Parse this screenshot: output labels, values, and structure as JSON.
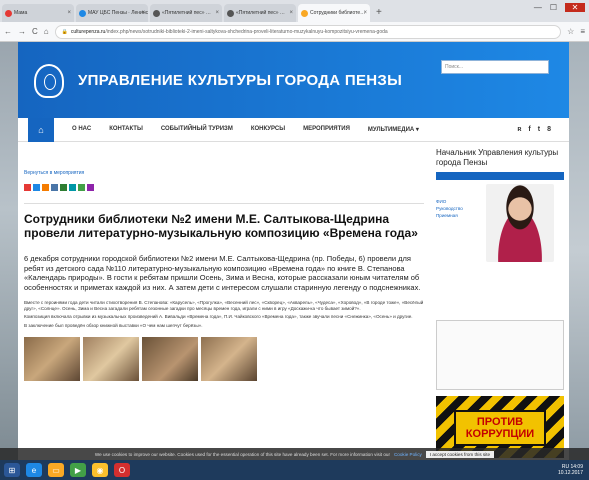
{
  "browser": {
    "tabs": [
      {
        "label": "Мама",
        "active": false,
        "color": "#e53935"
      },
      {
        "label": "МАУ ЦБС Пензы · Ленинс",
        "active": false,
        "color": "#1e88e5"
      },
      {
        "label": "«Пятилетний пес» …",
        "active": false,
        "color": "#555555"
      },
      {
        "label": "«Пятилетний пес» …",
        "active": false,
        "color": "#555555"
      },
      {
        "label": "Сотрудники библиоте…",
        "active": true,
        "color": "#f9a825"
      }
    ],
    "new_tab": "+",
    "url_host": "culturepenza.ru",
    "url_path": "/index.php/news/sotrudniki-biblioteki-2-imeni-saltykova-shchedrina-proveli-literaturno-muzykalnuyu-kompozitsiyu-vremena-goda"
  },
  "site": {
    "title": "УПРАВЛЕНИЕ КУЛЬТУРЫ ГОРОДА ПЕНЗЫ",
    "search_placeholder": "Поиск..."
  },
  "nav": {
    "items": [
      "О НАС",
      "КОНТАКТЫ",
      "СОБЫТИЙНЫЙ ТУРИЗМ",
      "КОНКУРСЫ",
      "МЕРОПРИЯТИЯ",
      "МУЛЬТИМЕДИА ▾"
    ],
    "social": [
      "ʀ",
      "f",
      "t",
      "8"
    ]
  },
  "article": {
    "breadcrumb": "Вернуться в мероприятия",
    "share_colors": [
      "#e53935",
      "#1e88e5",
      "#f57c00",
      "#4a76a8",
      "#2e7d32",
      "#0097a7",
      "#43a047",
      "#8e24aa"
    ],
    "title": "Сотрудники библиотеки №2 имени М.Е. Салтыкова-Щедрина провели литературно-музыкальную композицию «Времена года»",
    "lead": "6 декабря сотрудники городской библиотеки №2 имени М.Е. Салтыкова-Щедрина (пр. Победы, 6) провели для ребят из детского сада №110 литературно-музыкальную композицию «Времена года» по книге В. Степанова «Календарь природы». В гости к ребятам пришли Осень, Зима и Весна, которые рассказали юным читателям об особенностях и приметах каждой из них. А затем дети с интересом слушали старинную легенду о подснежниках.",
    "body_1": "Вместе с героинями года дети читали стихотворения В. Степанова: «Карусель», «Прогулка», «Весенний лес», «Скворец», «Акварель», «Чудеса», «Хоровод», «В городе тоже», «Весёлый друг», «Солнце». Осень, Зима и Весна загадали ребятам сезонные загадки про месяцы времен года, играли с ними в игру «Доскажи-ка что бывает зимой?».",
    "body_2": "Композиция включала отрывки из музыкальных произведений А. Вивальди «Времена года», П.И. Чайковского «Времена года», также звучали песни «Снежинка», «Осень» и другие.",
    "body_3": "В заключение был проведён обзор книжной выставки «О чем нам шепчут берёзы».",
    "photos": 4
  },
  "sidebar": {
    "heading": "Начальник Управления культуры города Пензы",
    "links": [
      "ФИО",
      "Руководство",
      "Приемная"
    ]
  },
  "banner": {
    "line1": "ПРОТИВ",
    "line2": "КОРРУПЦИИ"
  },
  "cookie": {
    "text": "We use cookies to improve our website. Cookies used for the essential operation of this site have already been set. For more information visit our",
    "link": "Cookie Policy",
    "button": "I accept cookies from this site"
  },
  "taskbar": {
    "icons": [
      {
        "name": "start-icon",
        "glyph": "⊞",
        "color": "#2b5797"
      },
      {
        "name": "ie-icon",
        "glyph": "e",
        "color": "#1e88e5"
      },
      {
        "name": "folder-icon",
        "glyph": "▭",
        "color": "#f9a825"
      },
      {
        "name": "media-icon",
        "glyph": "▶",
        "color": "#43a047"
      },
      {
        "name": "chrome-icon",
        "glyph": "◉",
        "color": "#fbc02d"
      },
      {
        "name": "opera-icon",
        "glyph": "O",
        "color": "#d32f2f"
      }
    ],
    "lang": "RU",
    "time": "14:09",
    "date": "10.12.2017"
  }
}
